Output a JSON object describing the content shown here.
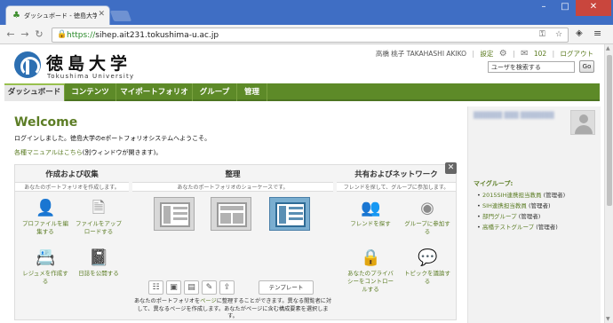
{
  "browser": {
    "tab_title": "ダッシュボード - 徳島大学 eポ",
    "url_scheme": "https://",
    "url_host": "sihep.ait231.tokushima-u.ac.jp"
  },
  "logo": {
    "name_jp": "徳島大学",
    "name_en": "Tokushima University"
  },
  "user": {
    "name": "高橋 桃子 TAKAHASHI AKIKO",
    "settings": "設定",
    "notifications": "102",
    "logout": "ログアウト",
    "search_placeholder": "ユーザを検索する",
    "go": "Go"
  },
  "nav": [
    "ダッシュボード",
    "コンテンツ",
    "マイポートフォリオ",
    "グループ",
    "管理"
  ],
  "welcome": {
    "title": "Welcome",
    "message": "ログインしました。徳島大学のeポートフォリオシステムへようこそ。",
    "manual_link": "各種マニュアルはこちら",
    "manual_suffix": "(別ウィンドウが開きます)。"
  },
  "dashboard": {
    "create": {
      "title": "作成および収集",
      "subtitle": "あなたのポートフォリオを作成します。",
      "actions": [
        "プロファイルを編集する",
        "ファイルをアップロードする",
        "レジュメを作成する",
        "日誌を公開する"
      ]
    },
    "organize": {
      "title": "整理",
      "subtitle": "あなたのポートフォリオのショーケースです。",
      "template_label": "テンプレート",
      "description_pre": "あなたのポートフォリオを",
      "description_link": "ページ",
      "description_post": "に整理することができます。異なる閲覧者に対して、異なるページを作成します。あなたがページに含む構成要素を選択します。"
    },
    "share": {
      "title": "共有およびネットワーク",
      "subtitle": "フレンドを探して、グループに参加します。",
      "actions": [
        "フレンドを探す",
        "グループに参加する",
        "あなたのプライバシーをコントロールする",
        "トピックを議論する"
      ]
    }
  },
  "sidebar": {
    "profile_name": "██████ ███ ███████",
    "groups_heading": "マイグループ:",
    "groups": [
      {
        "name": "2015SIH連携担当教員",
        "role": "(管理者)"
      },
      {
        "name": "SIH連携担当教員",
        "role": "(管理者)"
      },
      {
        "name": "部門グループ",
        "role": "(管理者)"
      },
      {
        "name": "高橋テストグループ",
        "role": "(管理者)"
      }
    ]
  }
}
